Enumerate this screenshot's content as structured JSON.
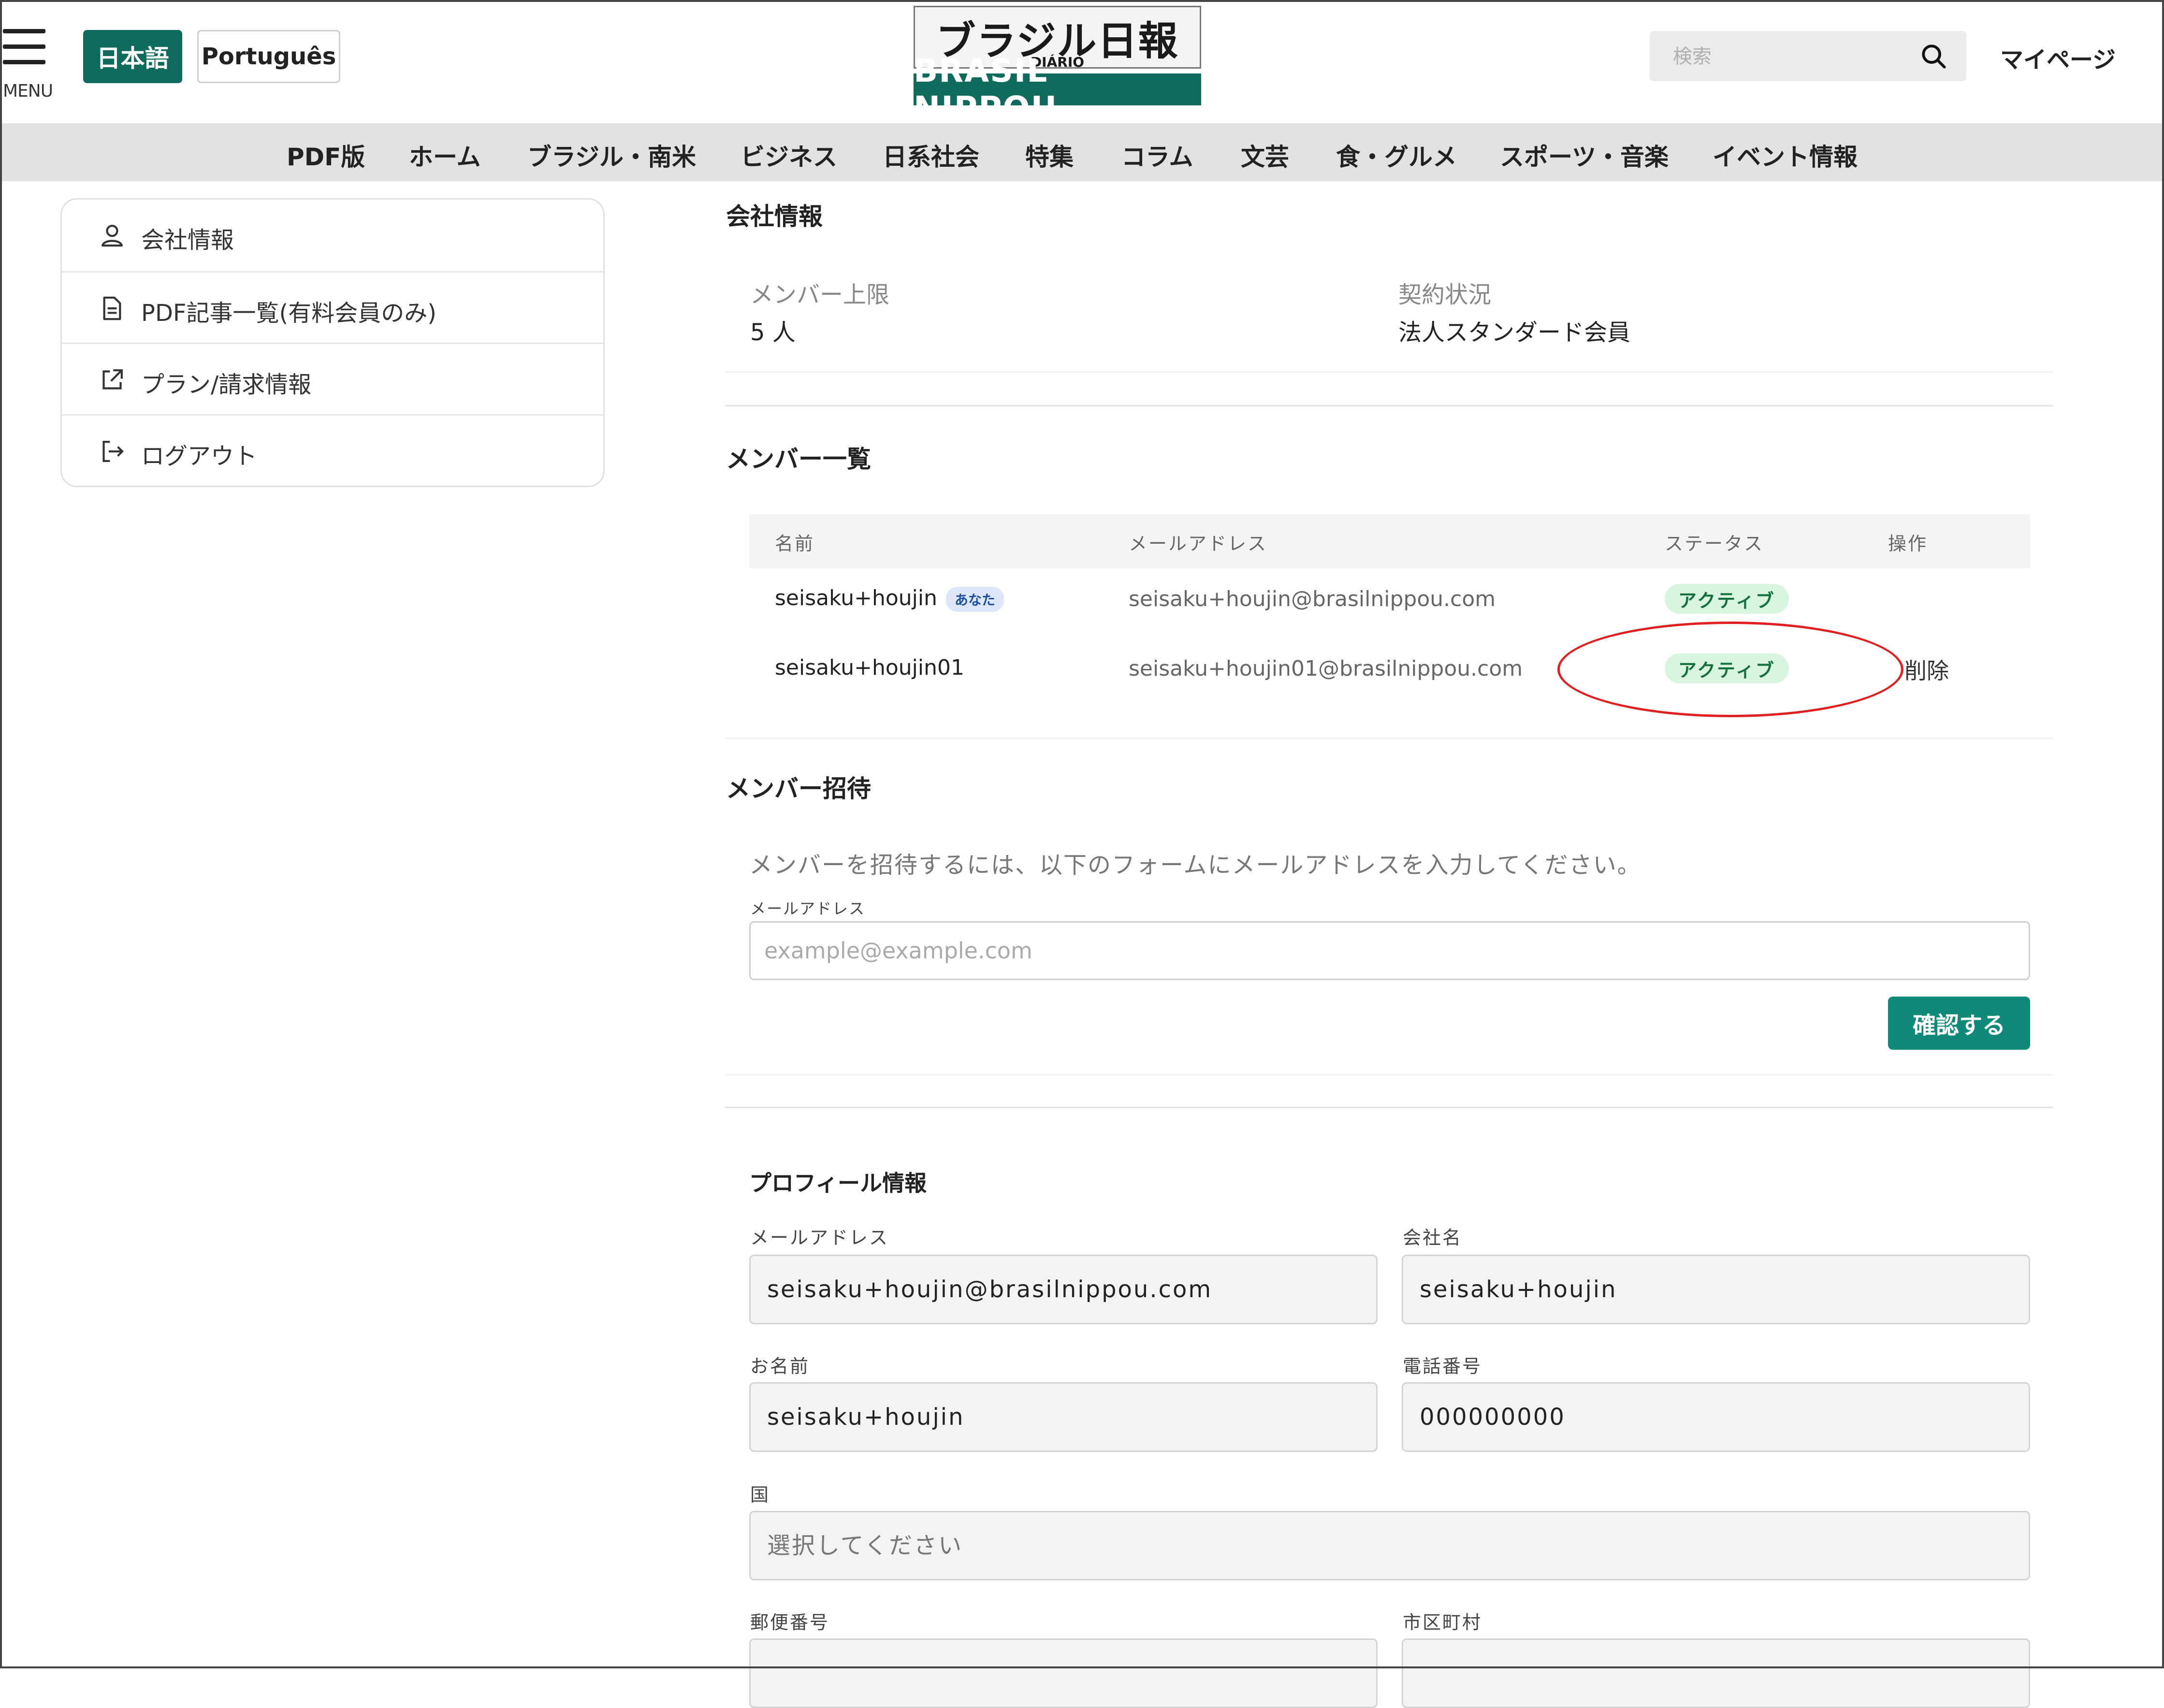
{
  "header": {
    "menu_label": "MENU",
    "lang_ja": "日本語",
    "lang_pt": "Português",
    "logo_title": "ブラジル日報",
    "logo_sub": "DIÁRIO",
    "logo_brand": "BRASIL NIPPOU",
    "search_placeholder": "検索",
    "mypage": "マイページ"
  },
  "nav": [
    "PDF版",
    "ホーム",
    "ブラジル・南米",
    "ビジネス",
    "日系社会",
    "特集",
    "コラム",
    "文芸",
    "食・グルメ",
    "スポーツ・音楽",
    "イベント情報"
  ],
  "sidebar": {
    "items": [
      {
        "label": "会社情報",
        "icon": "person-icon"
      },
      {
        "label": "PDF記事一覧(有料会員のみ)",
        "icon": "document-icon"
      },
      {
        "label": "プラン/請求情報",
        "icon": "external-link-icon"
      },
      {
        "label": "ログアウト",
        "icon": "logout-icon"
      }
    ]
  },
  "company": {
    "title": "会社情報",
    "member_limit_label": "メンバー上限",
    "member_limit_value": "5 人",
    "contract_label": "契約状況",
    "contract_value": "法人スタンダード会員"
  },
  "members": {
    "title": "メンバー一覧",
    "columns": [
      "名前",
      "メールアドレス",
      "ステータス",
      "操作"
    ],
    "you_badge": "あなた",
    "rows": [
      {
        "name": "seisaku+houjin",
        "email": "seisaku+houjin@brasilnippou.com",
        "status": "アクティブ",
        "action": ""
      },
      {
        "name": "seisaku+houjin01",
        "email": "seisaku+houjin01@brasilnippou.com",
        "status": "アクティブ",
        "action": "削除"
      }
    ]
  },
  "invite": {
    "title": "メンバー招待",
    "description": "メンバーを招待するには、以下のフォームにメールアドレスを入力してください。",
    "email_label": "メールアドレス",
    "email_placeholder": "example@example.com",
    "confirm": "確認する"
  },
  "profile": {
    "title": "プロフィール情報",
    "email_label": "メールアドレス",
    "email_value": "seisaku+houjin@brasilnippou.com",
    "company_label": "会社名",
    "company_value": "seisaku+houjin",
    "name_label": "お名前",
    "name_value": "seisaku+houjin",
    "phone_label": "電話番号",
    "phone_value": "000000000",
    "country_label": "国",
    "country_placeholder": "選択してください",
    "postal_label": "郵便番号",
    "city_label": "市区町村"
  },
  "colors": {
    "brand": "#0f6b5c",
    "button": "#0f8a78",
    "active_badge_bg": "#d9f5e0",
    "annotation": "#e02020"
  }
}
